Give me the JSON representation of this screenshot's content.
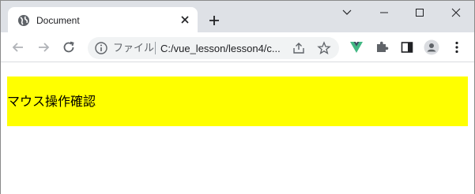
{
  "tab": {
    "title": "Document",
    "favicon": "globe-icon",
    "close_icon": "close-icon"
  },
  "window_controls": [
    "chevron-down-icon",
    "minimize-icon",
    "maximize-icon",
    "close-icon"
  ],
  "toolbar": {
    "back_icon": "back-arrow-icon",
    "forward_icon": "forward-arrow-icon",
    "reload_icon": "reload-icon",
    "extensions": [
      "vue-devtools-icon",
      "puzzle-icon",
      "side-panel-icon",
      "profile-icon",
      "kebab-menu-icon"
    ]
  },
  "omnibox": {
    "scheme_label": "ファイル",
    "url": "C:/vue_lesson/lesson4/c..."
  },
  "page": {
    "box_text": "マウス操作確認",
    "box_color": "#ffff00"
  }
}
